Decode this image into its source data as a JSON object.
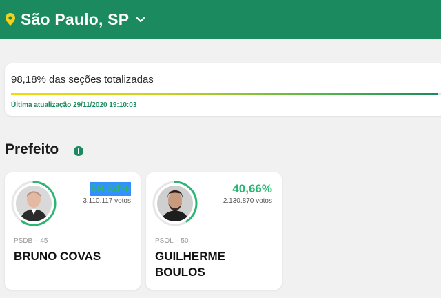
{
  "header": {
    "location": "São Paulo, SP",
    "location_icon": "map-pin-icon",
    "dropdown_icon": "chevron-down-icon",
    "background_color": "#1b8a5e"
  },
  "progress": {
    "label": "98,18% das seções totalizadas",
    "percent": 98.18,
    "updated": "Última atualização 29/11/2020 19:10:03"
  },
  "section": {
    "title": "Prefeito",
    "info_icon": "info-icon"
  },
  "candidates": [
    {
      "percent": "59,34%",
      "percent_selected": true,
      "votes": "3.110.117 votos",
      "party": "PSDB – 45",
      "name": "BRUNO COVAS",
      "vote_share": 0.5934
    },
    {
      "percent": "40,66%",
      "votes": "2.130.870 votos",
      "party": "PSOL – 50",
      "name_line1": "GUILHERME",
      "name_line2": "BOULOS",
      "vote_share": 0.4066
    }
  ],
  "colors": {
    "accent_green": "#2bb673",
    "brand_green": "#1b8a5e",
    "selection_blue": "#3390ff"
  }
}
